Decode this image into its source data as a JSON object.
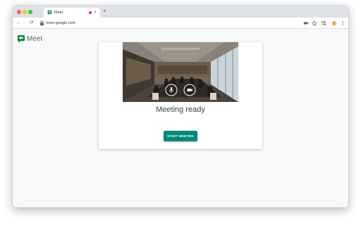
{
  "browser": {
    "tab_title": "Meet",
    "new_tab_symbol": "+",
    "tab_close_symbol": "×",
    "url": "meet.google.com",
    "back_symbol": "←",
    "forward_symbol": "→",
    "reload_symbol": "⟳"
  },
  "brand": {
    "name": "Meet"
  },
  "meeting": {
    "status": "Meeting ready",
    "start_button_label": "START MEETING"
  },
  "colors": {
    "accent": "#00897b",
    "brand_green": "#00832d"
  }
}
